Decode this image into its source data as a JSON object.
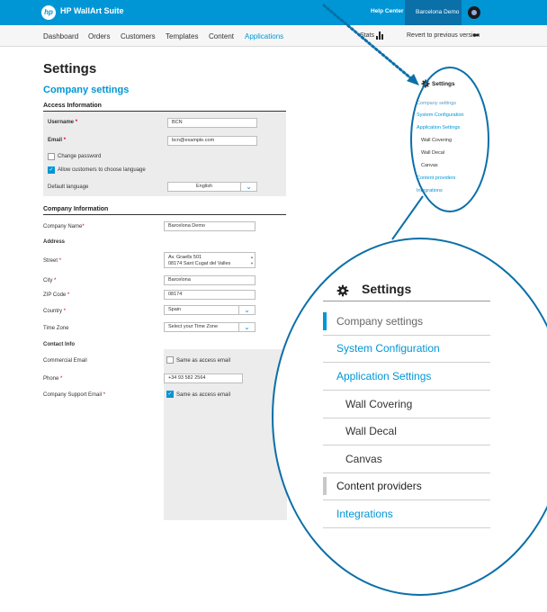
{
  "app": {
    "title": "HP WallArt Suite",
    "logo_text": "hp"
  },
  "topbar": {
    "help": "Help Center",
    "user": "Barcelona Demo"
  },
  "nav": {
    "items": [
      {
        "label": "Dashboard"
      },
      {
        "label": "Orders"
      },
      {
        "label": "Customers"
      },
      {
        "label": "Templates"
      },
      {
        "label": "Content"
      },
      {
        "label": "Applications"
      }
    ],
    "stats": "Stats",
    "revert": "Revert to previous version"
  },
  "page": {
    "title": "Settings",
    "subtitle": "Company settings"
  },
  "access": {
    "title": "Access Information",
    "username_label": "Username",
    "username_value": "BCN",
    "email_label": "Email",
    "email_value": "bcn@example.com",
    "change_password": "Change password",
    "allow_language": "Allow customers to choose language",
    "default_language_label": "Default language",
    "default_language_value": "English"
  },
  "company": {
    "title": "Company Information",
    "name_label": "Company Name",
    "name_value": "Barcelona Demo",
    "address_title": "Address",
    "street_label": "Street",
    "street_line1": "Av. Graells 501",
    "street_line2": "08174 Sant Cugat del Valles",
    "city_label": "City",
    "city_value": "Barcelona",
    "zip_label": "ZIP Code",
    "zip_value": "08174",
    "country_label": "Country",
    "country_value": "Spain",
    "timezone_label": "Time Zone",
    "timezone_value": "Select your Time Zone",
    "contact_title": "Contact Info",
    "commercial_email_label": "Commercial Email",
    "same_as_access": "Same as access email",
    "phone_label": "Phone",
    "phone_value": "+34 93 582 2564",
    "support_email_label": "Company Support Email",
    "same_as_access_2": "Same as access email"
  },
  "sidebar": {
    "title": "Settings",
    "items": [
      {
        "label": "Company settings"
      },
      {
        "label": "System Configuration"
      },
      {
        "label": "Application Settings"
      },
      {
        "label": "Wall Covering"
      },
      {
        "label": "Wall Decal"
      },
      {
        "label": "Canvas"
      },
      {
        "label": "Content providers"
      },
      {
        "label": "Integrations"
      }
    ]
  },
  "mini_sidebar": {
    "items": [
      {
        "label": "Company settings"
      },
      {
        "label": "System Configuration"
      },
      {
        "label": "Application Settings"
      },
      {
        "label": "Wall Covering"
      },
      {
        "label": "Wall Decal"
      },
      {
        "label": "Canvas"
      },
      {
        "label": "Content providers"
      },
      {
        "label": "Integrations"
      }
    ]
  },
  "colors": {
    "brand": "#0096d6",
    "user_bg": "#0b6fa8",
    "required": "#d0021b"
  },
  "icons": [
    "hp-logo-icon",
    "user-icon",
    "stats-bars-icon",
    "revert-arrow-icon",
    "gear-icon",
    "chevron-down-icon",
    "checkmark-icon"
  ]
}
